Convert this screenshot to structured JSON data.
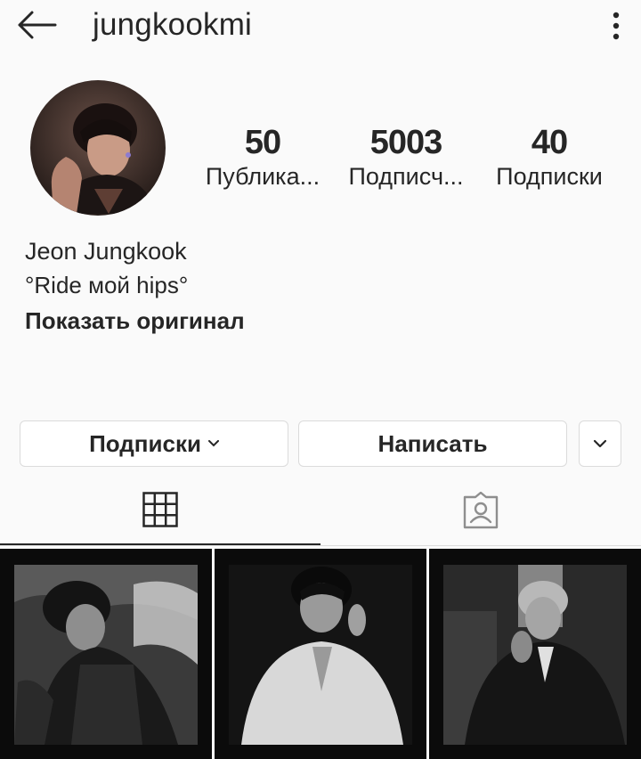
{
  "header": {
    "username": "jungkookmi",
    "back_icon": "arrow-left-icon",
    "menu_icon": "more-vertical-icon"
  },
  "stats": [
    {
      "value": "50",
      "label": "Публика..."
    },
    {
      "value": "5003",
      "label": "Подписч..."
    },
    {
      "value": "40",
      "label": "Подписки"
    }
  ],
  "bio": {
    "name": "Jeon Jungkook",
    "text": "°Ride мой hips°",
    "show_original": "Показать оригинал"
  },
  "actions": {
    "following_label": "Подписки",
    "message_label": "Написать"
  },
  "tabs": [
    {
      "icon": "grid-icon",
      "active": true
    },
    {
      "icon": "tagged-user-icon",
      "active": false
    }
  ],
  "posts": [
    {
      "description": "post-1"
    },
    {
      "description": "post-2"
    },
    {
      "description": "post-3"
    }
  ],
  "colors": {
    "background": "#fafafa",
    "text": "#262626",
    "border": "#dbdbdb"
  }
}
